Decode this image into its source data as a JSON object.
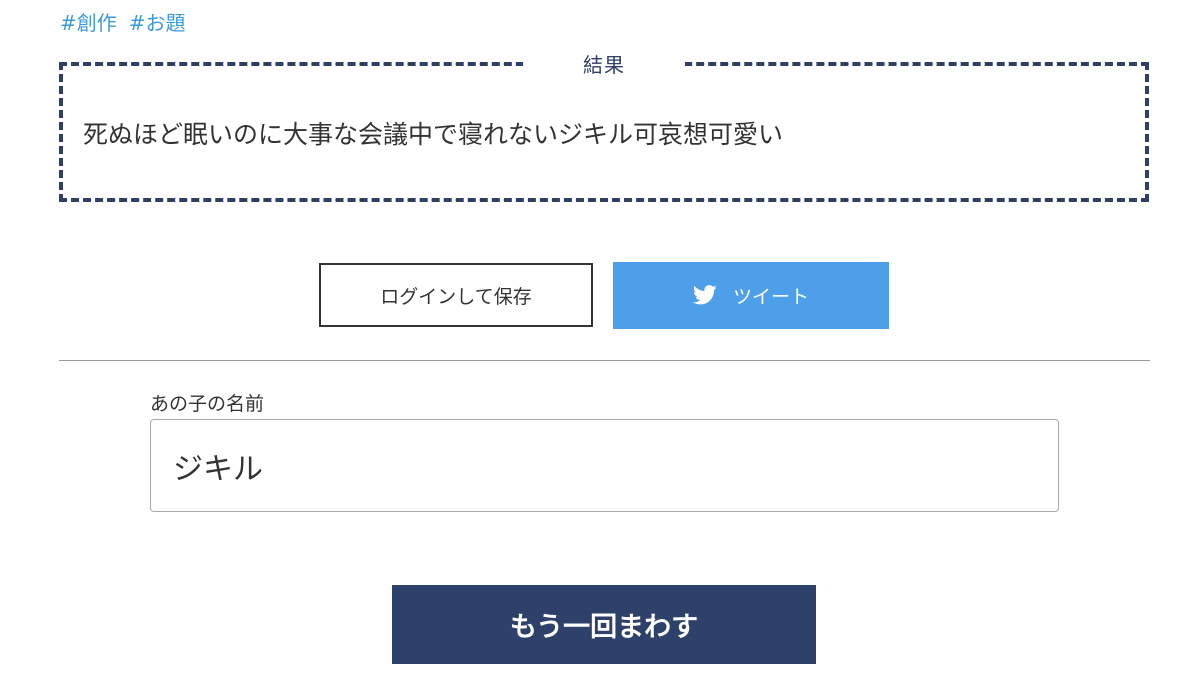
{
  "tags": [
    "#創作",
    "#お題"
  ],
  "result": {
    "label": "結果",
    "text": "死ぬほど眠いのに大事な会議中で寝れないジキル可哀想可愛い"
  },
  "actions": {
    "login_save_label": "ログインして保存",
    "tweet_label": "ツイート",
    "tweet_icon": "twitter-bird-icon"
  },
  "form": {
    "name_label": "あの子の名前",
    "name_value": "ジキル"
  },
  "spin_again_label": "もう一回まわす",
  "colors": {
    "tag": "#3d9ad8",
    "navy": "#2e416b",
    "tweet": "#4c9fe8"
  }
}
